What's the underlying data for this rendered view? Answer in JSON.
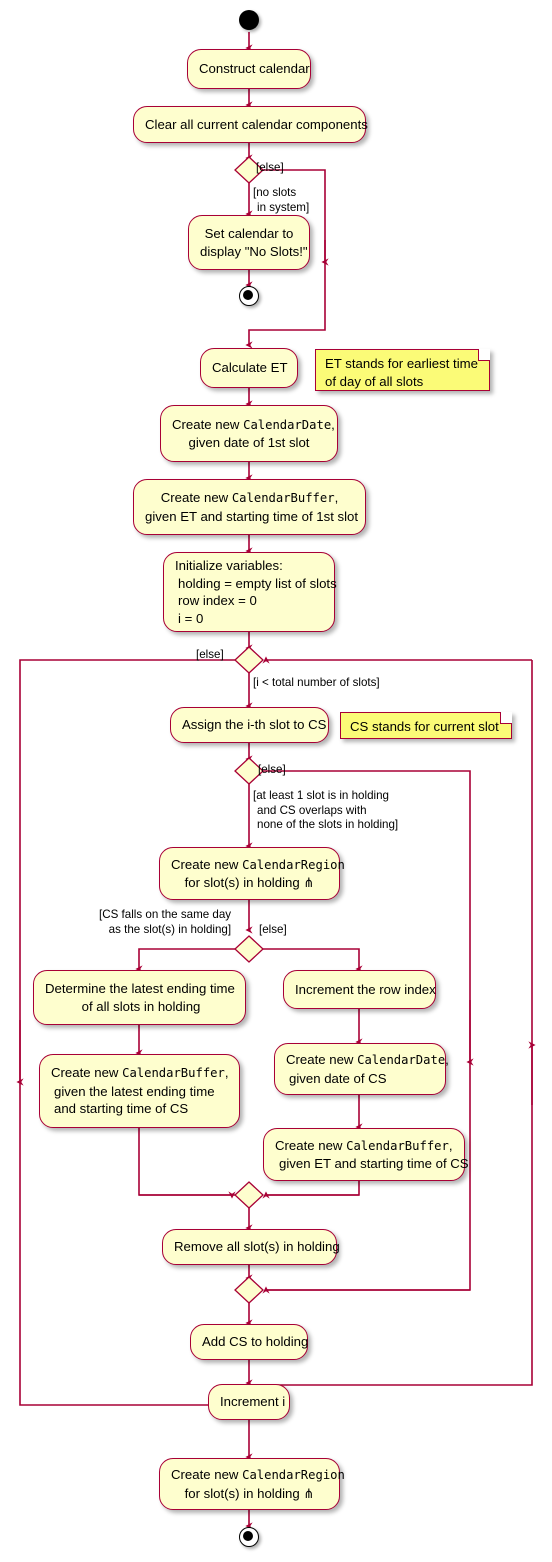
{
  "diagram": {
    "type": "uml-activity-diagram",
    "title": "Construct calendar activity",
    "colors": {
      "node_fill": "#FEFECE",
      "node_border": "#A80036",
      "note_fill": "#FBFB77",
      "edge": "#A80036",
      "text": "#000000",
      "background": "#FFFFFF"
    }
  },
  "nodes": {
    "start": "start",
    "construct_calendar": "Construct calendar",
    "clear_components": "Clear all current calendar components",
    "set_no_slots": {
      "line1": "Set calendar to",
      "line2": "display \"No Slots!\""
    },
    "end_no_slots": "end",
    "calculate_et": "Calculate ET",
    "create_calendar_date_first": {
      "line1_pre": "Create new ",
      "line1_mono": "CalendarDate",
      "line1_post": ",",
      "line2": "given date of 1st slot"
    },
    "create_calendar_buffer_first": {
      "line1_pre": "Create new ",
      "line1_mono": "CalendarBuffer",
      "line1_post": ",",
      "line2": "given ET and starting time of 1st slot"
    },
    "initialize_variables": {
      "line1": "Initialize variables:",
      "line2": "holding = empty list of slots",
      "line3": "row index = 0",
      "line4": "i = 0"
    },
    "assign_cs": "Assign the i-th slot to CS",
    "create_calendar_region_loop": {
      "line1_pre": "Create new ",
      "line1_mono": "CalendarRegion",
      "line2": "for slot(s) in holding ⋔"
    },
    "determine_latest_ending": {
      "line1": "Determine the latest ending time",
      "line2": "of all slots in holding"
    },
    "create_buffer_latest": {
      "line1_pre": "Create new ",
      "line1_mono": "CalendarBuffer",
      "line1_post": ",",
      "line2": "given the latest ending time",
      "line3": "and starting time of CS"
    },
    "increment_row_index": "Increment the row index",
    "create_calendar_date_cs": {
      "line1_pre": "Create new ",
      "line1_mono": "CalendarDate",
      "line1_post": ",",
      "line2": "given date of CS"
    },
    "create_buffer_cs": {
      "line1_pre": "Create new ",
      "line1_mono": "CalendarBuffer",
      "line1_post": ",",
      "line2": "given ET and starting time of CS"
    },
    "remove_holding": "Remove all slot(s) in holding",
    "add_cs_holding": "Add CS to holding",
    "increment_i": "Increment i",
    "create_calendar_region_final": {
      "line1_pre": "Create new ",
      "line1_mono": "CalendarRegion",
      "line2": "for slot(s) in holding ⋔"
    },
    "end_final": "end"
  },
  "notes": {
    "et_note": {
      "line1": "ET stands for earliest time",
      "line2": "of day of all slots"
    },
    "cs_note": {
      "line1": "CS stands for current slot"
    }
  },
  "guards": {
    "else_1": "[else]",
    "no_slots_in_system": {
      "line1": "[no slots",
      "line2": "in system]"
    },
    "else_loop": "[else]",
    "loop_cond": "[i < total number of slots]",
    "else_overlap": "[else]",
    "overlap_cond": {
      "line1": "[at least 1 slot is in holding",
      "line2": "and CS overlaps with",
      "line3": "none of the slots in holding]"
    },
    "same_day_cond": {
      "line1": "[CS falls on the same day",
      "line2": "as the slot(s) in holding]"
    },
    "else_same_day": "[else]"
  }
}
